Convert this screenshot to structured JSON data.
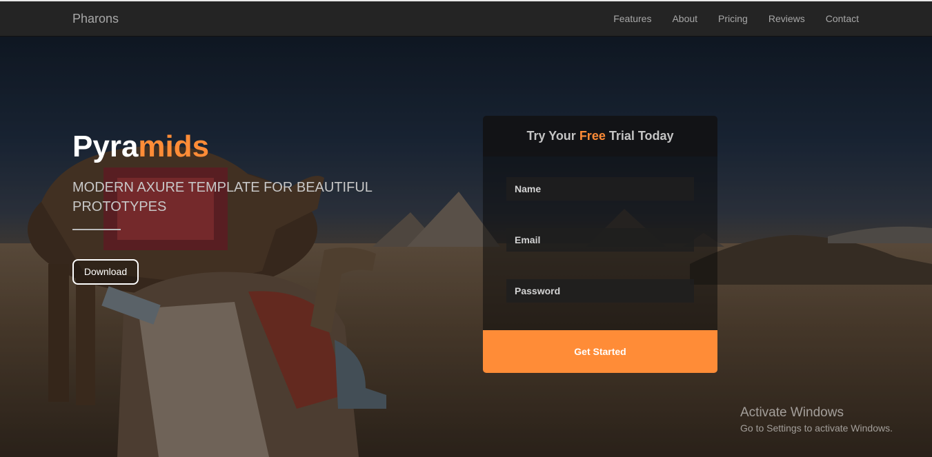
{
  "navbar": {
    "brand": "Pharons",
    "links": [
      "Features",
      "About",
      "Pricing",
      "Reviews",
      "Contact"
    ]
  },
  "hero": {
    "title_part1": "Pyra",
    "title_part2": "mids",
    "subtitle": "MODERN AXURE TEMPLATE FOR BEAUTIFUL PROTOTYPES",
    "download_label": "Download"
  },
  "form": {
    "heading_part1": "Try Your ",
    "heading_accent": "Free",
    "heading_part2": " Trial Today",
    "name_placeholder": "Name",
    "email_placeholder": "Email",
    "password_placeholder": "Password",
    "submit_label": "Get Started"
  },
  "watermark": {
    "title": "Activate Windows",
    "subtitle": "Go to Settings to activate Windows."
  },
  "colors": {
    "accent": "#ff8c37",
    "navbar_bg": "#242424",
    "form_head_bg": "#121214"
  }
}
